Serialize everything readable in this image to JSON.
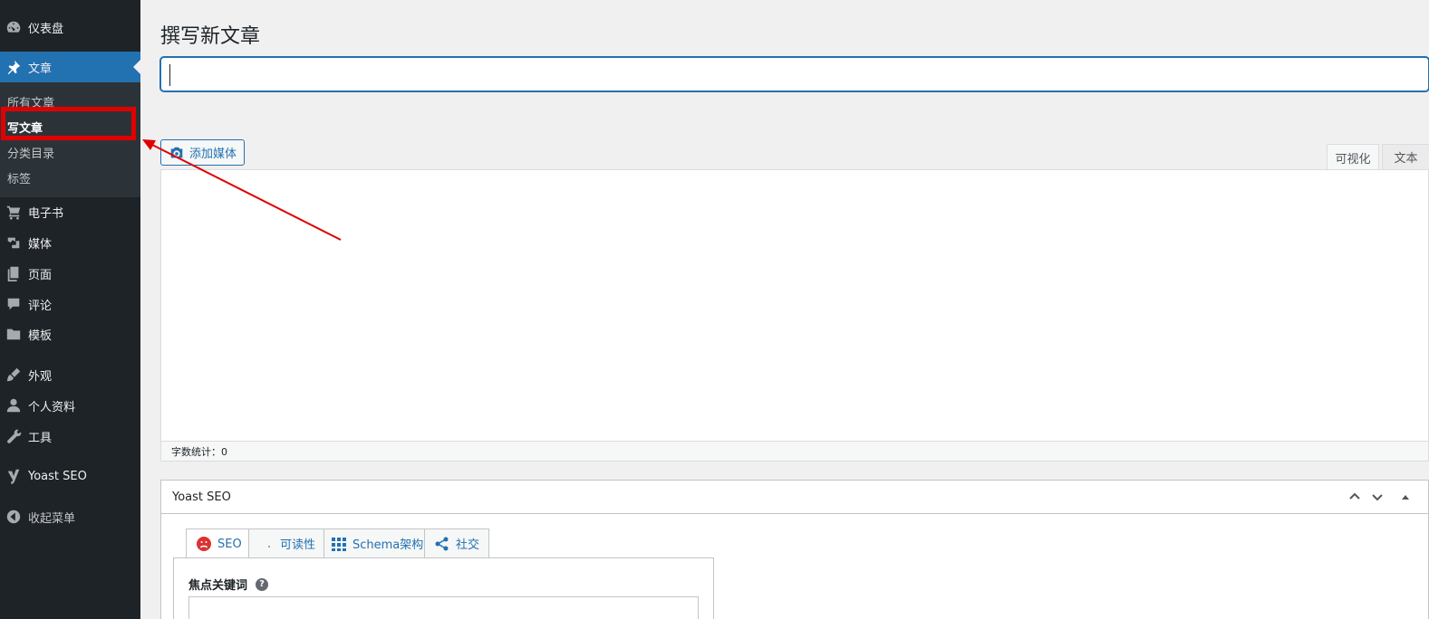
{
  "sidebar": {
    "dashboard": "仪表盘",
    "posts": "文章",
    "posts_submenu": [
      "所有文章",
      "写文章",
      "分类目录",
      "标签"
    ],
    "ebook": "电子书",
    "media": "媒体",
    "pages": "页面",
    "comments": "评论",
    "templates": "模板",
    "appearance": "外观",
    "profile": "个人资料",
    "tools": "工具",
    "yoast": "Yoast SEO",
    "collapse": "收起菜单"
  },
  "editor": {
    "page_title": "撰写新文章",
    "title_value": "",
    "add_media": "添加媒体",
    "tab_visual": "可视化",
    "tab_text": "文本",
    "word_count": "字数统计：0"
  },
  "yoast": {
    "title": "Yoast SEO",
    "tabs": [
      "SEO",
      "可读性",
      "Schema架构",
      "社交"
    ],
    "focus_keyword_label": "焦点关键词",
    "help": "?",
    "focus_keyword_value": ""
  },
  "colors": {
    "sidebar_bg": "#1d2327",
    "active_blue": "#2271b1",
    "highlight_red": "#e00000"
  }
}
